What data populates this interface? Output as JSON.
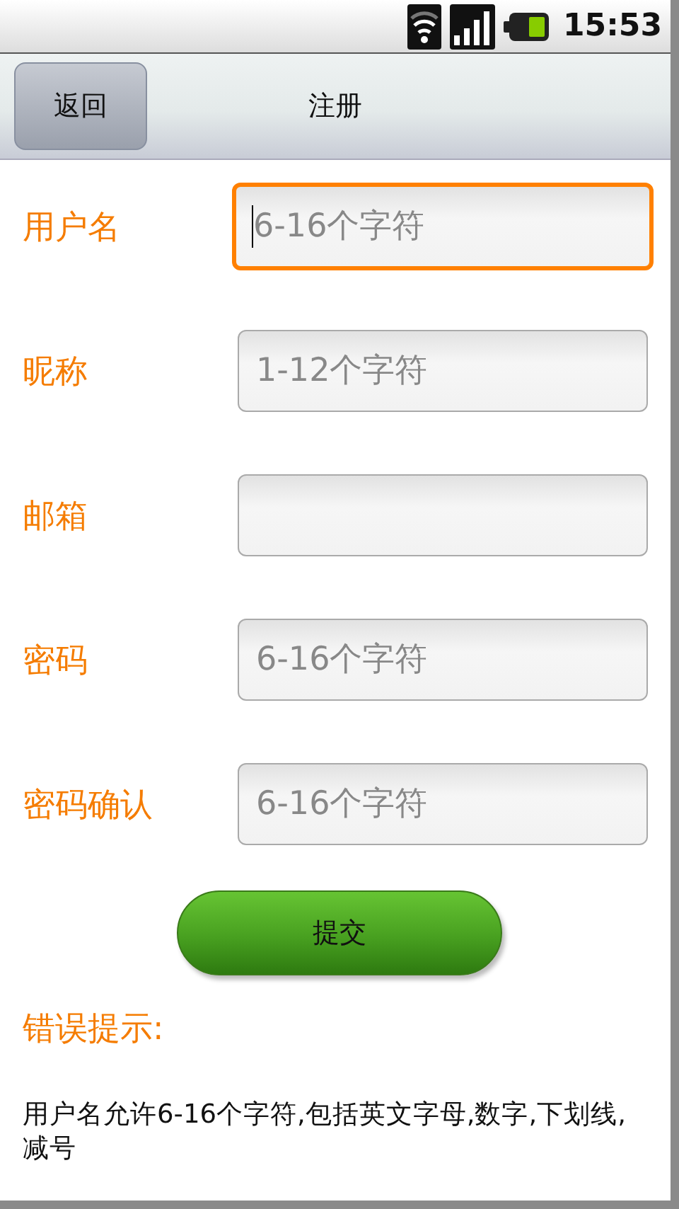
{
  "status_bar": {
    "time": "15:53"
  },
  "title_bar": {
    "back_button": "返回",
    "title": "注册"
  },
  "fields": [
    {
      "label": "用户名",
      "placeholder": "6-16个字符",
      "focused": true
    },
    {
      "label": "昵称",
      "placeholder": "1-12个字符",
      "focused": false
    },
    {
      "label": "邮箱",
      "focused": false
    },
    {
      "label": "密码",
      "placeholder": "6-16个字符",
      "focused": false
    },
    {
      "label": "密码确认",
      "placeholder": "6-16个字符",
      "focused": false
    }
  ],
  "submit_button": "提交",
  "error": {
    "heading": "错误提示:",
    "message": "用户名允许6-16个字符,包括英文字母,数字,下划线,减号"
  }
}
